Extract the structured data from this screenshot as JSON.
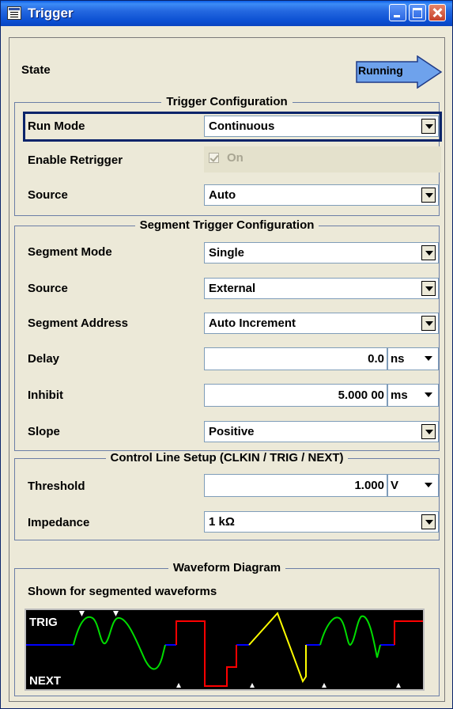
{
  "window": {
    "title": "Trigger"
  },
  "state": {
    "label": "State",
    "status": "Running"
  },
  "trigger_config": {
    "title": "Trigger Configuration",
    "run_mode": {
      "label": "Run Mode",
      "value": "Continuous"
    },
    "enable_retrigger": {
      "label": "Enable Retrigger",
      "checkbox_text": "On",
      "checked": true,
      "enabled": false
    },
    "source": {
      "label": "Source",
      "value": "Auto"
    }
  },
  "segment_config": {
    "title": "Segment Trigger Configuration",
    "segment_mode": {
      "label": "Segment Mode",
      "value": "Single"
    },
    "source": {
      "label": "Source",
      "value": "External"
    },
    "segment_address": {
      "label": "Segment Address",
      "value": "Auto Increment"
    },
    "delay": {
      "label": "Delay",
      "value": "0.0",
      "unit": "ns"
    },
    "inhibit": {
      "label": "Inhibit",
      "value": "5.000 00",
      "unit": "ms"
    },
    "slope": {
      "label": "Slope",
      "value": "Positive"
    }
  },
  "control_line": {
    "title": "Control Line Setup (CLKIN / TRIG / NEXT)",
    "threshold": {
      "label": "Threshold",
      "value": "1.000",
      "unit": "V"
    },
    "impedance": {
      "label": "Impedance",
      "value": "1 kΩ"
    }
  },
  "waveform": {
    "title": "Waveform Diagram",
    "caption": "Shown for segmented waveforms",
    "trig_label": "TRIG",
    "next_label": "NEXT"
  },
  "colors": {
    "blue": "#0000ff",
    "green": "#00dd00",
    "red": "#ff0000",
    "yellow": "#ffff00",
    "running_fill": "#6ea2ec"
  }
}
